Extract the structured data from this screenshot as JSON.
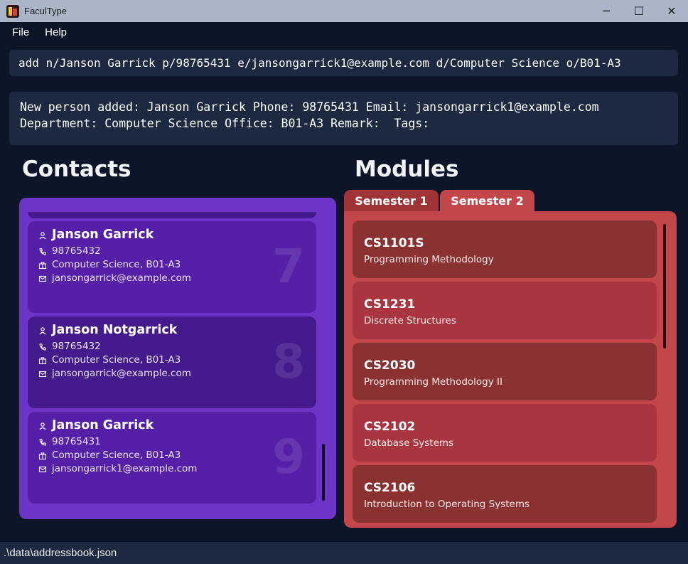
{
  "window": {
    "title": "FaculType",
    "controls": {
      "minimize": "─",
      "maximize": "☐",
      "close": "✕"
    }
  },
  "menu": {
    "file": "File",
    "help": "Help"
  },
  "command": {
    "value": "add n/Janson Garrick p/98765431 e/jansongarrick1@example.com d/Computer Science o/B01-A3"
  },
  "result": {
    "line1": "New person added: Janson Garrick Phone: 98765431 Email: jansongarrick1@example.com",
    "line2": "Department: Computer Science Office: B01-A3 Remark:  Tags:"
  },
  "contacts": {
    "heading": "Contacts",
    "cards": [
      {
        "index": "7",
        "name": "Janson Garrick",
        "phone": "98765432",
        "dept_office": "Computer Science, B01-A3",
        "email": "jansongarrick@example.com"
      },
      {
        "index": "8",
        "name": "Janson Notgarrick",
        "phone": "98765432",
        "dept_office": "Computer Science, B01-A3",
        "email": "jansongarrick@example.com"
      },
      {
        "index": "9",
        "name": "Janson Garrick",
        "phone": "98765431",
        "dept_office": "Computer Science, B01-A3",
        "email": "jansongarrick1@example.com"
      }
    ]
  },
  "modules": {
    "heading": "Modules",
    "tabs": [
      {
        "label": "Semester 1",
        "selected": false
      },
      {
        "label": "Semester 2",
        "selected": true
      }
    ],
    "items": [
      {
        "code": "CS1101S",
        "name": "Programming Methodology"
      },
      {
        "code": "CS1231",
        "name": "Discrete Structures"
      },
      {
        "code": "CS2030",
        "name": "Programming Methodology II"
      },
      {
        "code": "CS2102",
        "name": "Database Systems"
      },
      {
        "code": "CS2106",
        "name": "Introduction to Operating Systems"
      }
    ]
  },
  "status": {
    "path": ".\\data\\addressbook.json"
  },
  "colors": {
    "background": "#0d1628",
    "box": "#1c2940",
    "contacts_panel": "#6c34c7",
    "card_even": "#551fa8",
    "card_odd": "#451a8c",
    "modules_panel": "#c3474a",
    "module_dark": "#8a3131",
    "module_light": "#a83540",
    "tab_unselected": "#a03436"
  }
}
